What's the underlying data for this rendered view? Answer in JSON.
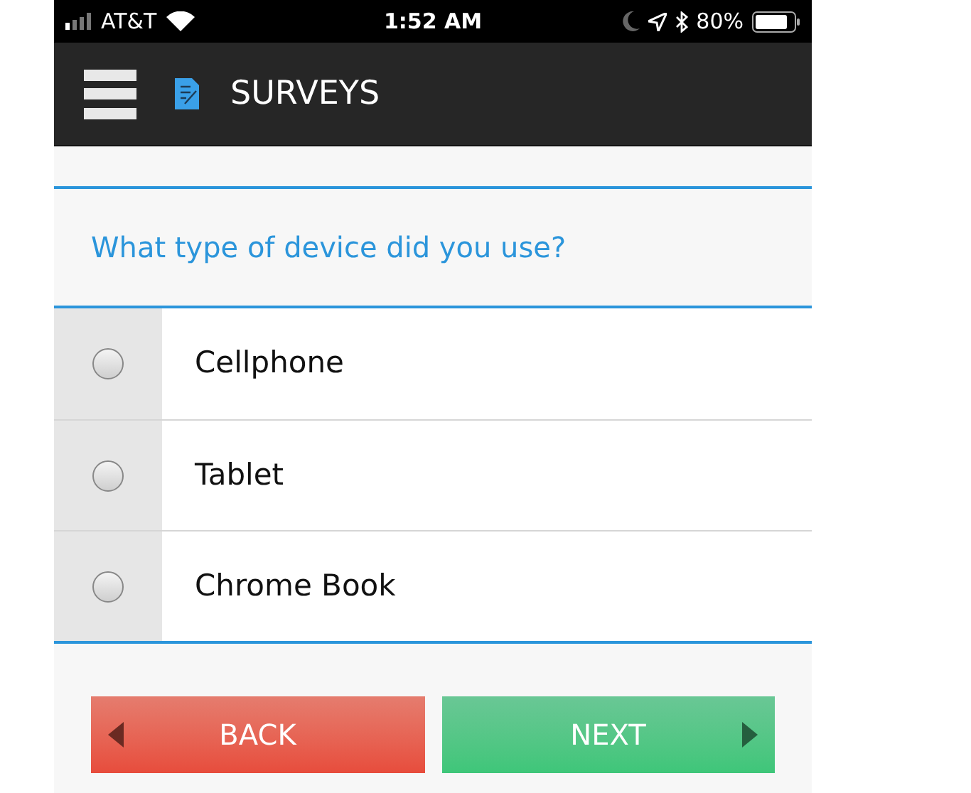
{
  "status_bar": {
    "carrier": "AT&T",
    "time": "1:52 AM",
    "battery": "80%"
  },
  "header": {
    "title": "SURVEYS"
  },
  "question": {
    "text": "What type of device did you use?"
  },
  "options": [
    {
      "label": "Cellphone",
      "selected": false
    },
    {
      "label": "Tablet",
      "selected": false
    },
    {
      "label": "Chrome Book",
      "selected": false
    }
  ],
  "buttons": [
    {
      "kind": "back",
      "label": "BACK"
    },
    {
      "kind": "next",
      "label": "NEXT"
    }
  ]
}
